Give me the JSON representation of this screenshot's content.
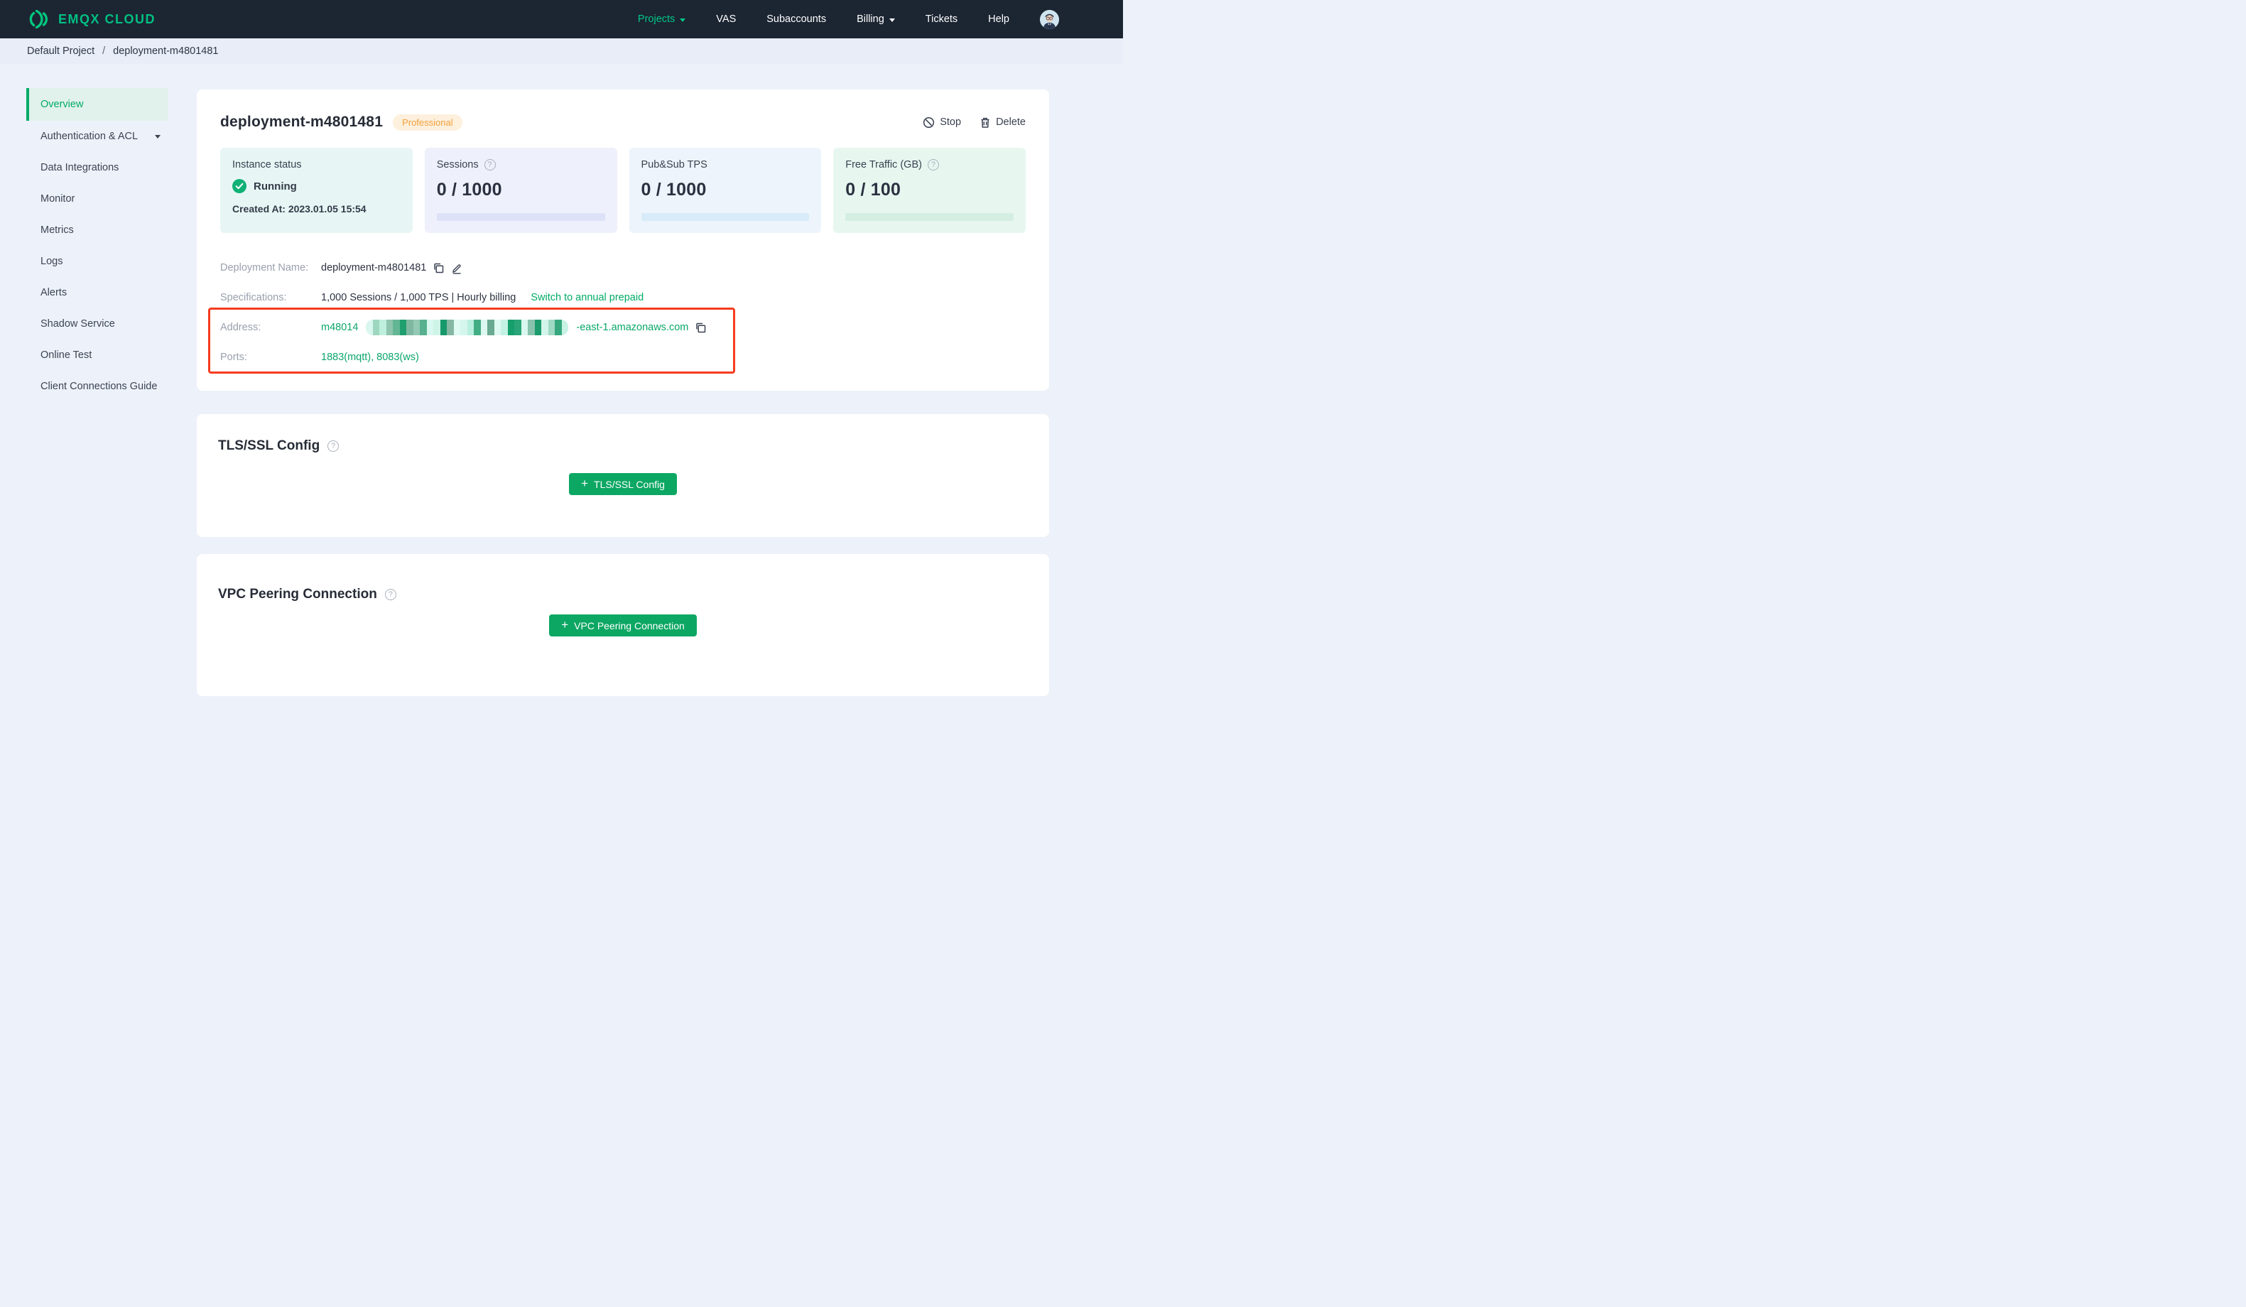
{
  "navbar": {
    "brand": "EMQX CLOUD",
    "items": [
      {
        "label": "Projects"
      },
      {
        "label": "VAS"
      },
      {
        "label": "Subaccounts"
      },
      {
        "label": "Billing"
      },
      {
        "label": "Tickets"
      },
      {
        "label": "Help"
      }
    ]
  },
  "breadcrumb": {
    "project": "Default Project",
    "separator": "/",
    "current": "deployment-m4801481"
  },
  "sidebar": {
    "items": [
      {
        "label": "Overview"
      },
      {
        "label": "Authentication & ACL"
      },
      {
        "label": "Data Integrations"
      },
      {
        "label": "Monitor"
      },
      {
        "label": "Metrics"
      },
      {
        "label": "Logs"
      },
      {
        "label": "Alerts"
      },
      {
        "label": "Shadow Service"
      },
      {
        "label": "Online Test"
      },
      {
        "label": "Client Connections Guide"
      }
    ]
  },
  "deployment": {
    "title": "deployment-m4801481",
    "plan_badge": "Professional",
    "stop_label": "Stop",
    "delete_label": "Delete",
    "stats": {
      "instance": {
        "label": "Instance status",
        "status": "Running",
        "created_at": "Created At: 2023.01.05 15:54"
      },
      "sessions": {
        "label": "Sessions",
        "value": "0 / 1000"
      },
      "tps": {
        "label": "Pub&Sub TPS",
        "value": "0 / 1000"
      },
      "traffic": {
        "label": "Free Traffic (GB)",
        "value": "0 / 100"
      }
    },
    "details": {
      "name_label": "Deployment Name:",
      "name_value": "deployment-m4801481",
      "spec_label": "Specifications:",
      "spec_value": "1,000 Sessions / 1,000 TPS | Hourly billing",
      "spec_link": "Switch to annual prepaid",
      "address_label": "Address:",
      "address_prefix": "m48014",
      "address_suffix": "-east-1.amazonaws.com",
      "ports_label": "Ports:",
      "ports_value": "1883(mqtt), 8083(ws)"
    }
  },
  "tls_section": {
    "title": "TLS/SSL Config",
    "button_label": "TLS/SSL Config"
  },
  "vpc_section": {
    "title": "VPC Peering Connection",
    "button_label": "VPC Peering Connection"
  },
  "colors": {
    "navbar_bg": "#1c2532",
    "page_bg": "#edf1f9",
    "accent_green": "#00ab66",
    "brand_green": "#00bf82",
    "button_green": "#0ca763",
    "badge_orange": "#f2a03c",
    "badge_bg": "#fdf0dd",
    "annotation_red": "#f43c1e",
    "running_check_green": "#10b176"
  },
  "redaction": {
    "mosaic_colors": [
      "#d9f7ee",
      "#9fd6c0",
      "#bff0de",
      "#8fc4ae",
      "#63b694",
      "#1f9e6e",
      "#7fb8a1",
      "#94c9b3",
      "#57b18e",
      "#d9f8f0",
      "#cef4e8",
      "#17996b",
      "#86b7a5",
      "#defaf2",
      "#d5f6ec",
      "#b9efde",
      "#43ad85",
      "#dcf8f0",
      "#6aa992",
      "#def9f1",
      "#c3f2e4",
      "#169e6d",
      "#2aa577",
      "#d9f7ee",
      "#89c3ad",
      "#1c9b6d",
      "#d2f5ea",
      "#9fd9c4",
      "#36a87e",
      "#c7f2e4"
    ]
  }
}
